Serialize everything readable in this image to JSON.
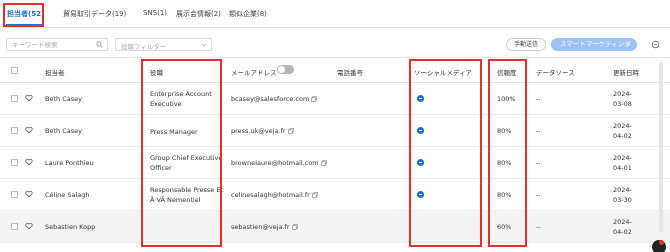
{
  "tabs": [
    {
      "label": "担当者(52)",
      "active": true
    },
    {
      "label": "貿易取引データ(19)",
      "active": false
    },
    {
      "label": "SNS(1)",
      "active": false
    },
    {
      "label": "展示会情報(2)",
      "active": false
    },
    {
      "label": "類似企業(8)",
      "active": false
    }
  ],
  "toolbar": {
    "search_placeholder": "キーワード検索",
    "role_filter_placeholder": "役職フィルター",
    "manual_send_label": "手動送信",
    "smart_marketing_label": "スマートマーケティング"
  },
  "table": {
    "headers": {
      "contact": "担当者",
      "title": "役職",
      "email": "メールアドレス",
      "phone": "電話番号",
      "social": "ソーシャルメディア",
      "confidence": "信頼度",
      "source": "データソース",
      "updated": "更新日時"
    },
    "rows": [
      {
        "name": "Beth Casey",
        "title": "Enterprise Account Executive",
        "email": "bcasey@salesforce.com",
        "social": "linkedin",
        "confidence": "100%",
        "source": "--",
        "updated": "2024-03-08"
      },
      {
        "name": "Beth Casey",
        "title": "Press Manager",
        "email": "press.uk@veja.fr",
        "social": "linkedin",
        "confidence": "80%",
        "source": "--",
        "updated": "2024-04-02"
      },
      {
        "name": "Laure Ponthieu",
        "title": "Group Chief Executive Officer",
        "email": "browneIaure@hotmail.com",
        "social": "linkedin",
        "confidence": "80%",
        "source": "--",
        "updated": "2024-04-01"
      },
      {
        "name": "Céline Salagh",
        "title": "Responsable Presse Et Ã VÃ Nementiel",
        "email": "celinesalagh@hotmail.fr",
        "social": "linkedin",
        "confidence": "80%",
        "source": "--",
        "updated": "2024-03-30"
      },
      {
        "name": "Sebastien Kopp",
        "title": "",
        "email": "sebastien@veja.fr",
        "social": "",
        "confidence": "60%",
        "source": "--",
        "updated": "2024-04-02"
      }
    ]
  },
  "colors": {
    "accent": "#1f6fd1",
    "highlight": "#e0322b",
    "linkedin": "#1d70c9",
    "smart_button": "#9cc3f3"
  }
}
